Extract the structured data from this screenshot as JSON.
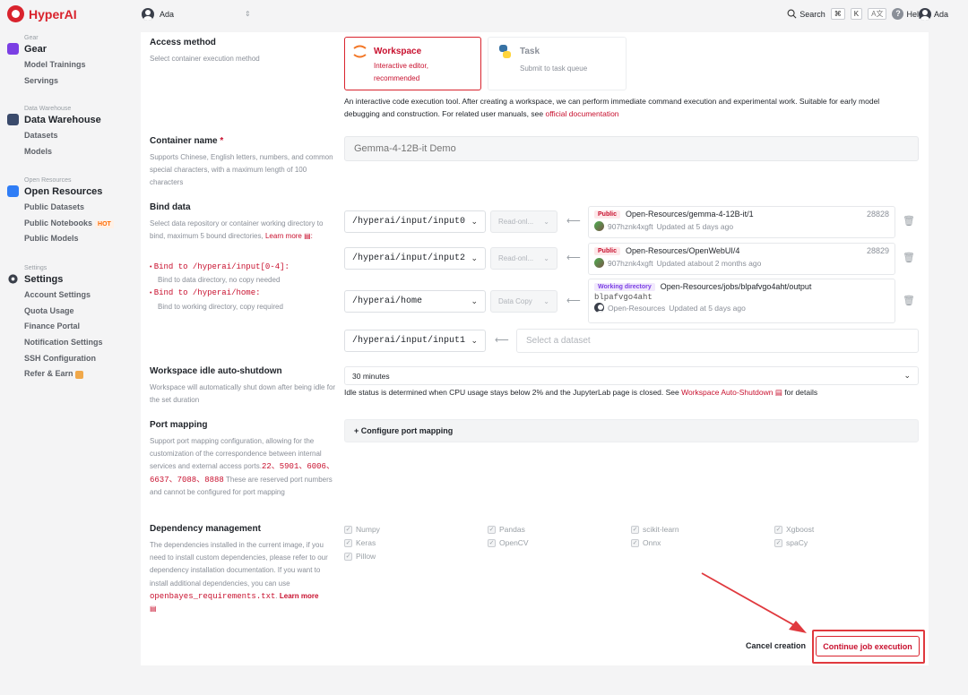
{
  "app": {
    "name": "HyperAI",
    "brand_color": "#d9232d"
  },
  "topbar": {
    "workspace_user": "Ada",
    "search_label": "Search",
    "shortcut_keys": [
      "⌘",
      "K"
    ],
    "help_label": "Help",
    "user_name": "Ada"
  },
  "sidebar": {
    "sections": [
      {
        "caption": "Gear",
        "title": "Gear",
        "items": [
          {
            "label": "Model Trainings"
          },
          {
            "label": "Servings"
          }
        ]
      },
      {
        "caption": "Data Warehouse",
        "title": "Data Warehouse",
        "items": [
          {
            "label": "Datasets"
          },
          {
            "label": "Models"
          }
        ]
      },
      {
        "caption": "Open Resources",
        "title": "Open Resources",
        "items": [
          {
            "label": "Public Datasets"
          },
          {
            "label": "Public Notebooks",
            "badge": "HOT"
          },
          {
            "label": "Public Models"
          }
        ]
      },
      {
        "caption": "Settings",
        "title": "Settings",
        "items": [
          {
            "label": "Account Settings"
          },
          {
            "label": "Quota Usage"
          },
          {
            "label": "Finance Portal"
          },
          {
            "label": "Notification Settings"
          },
          {
            "label": "SSH Configuration"
          },
          {
            "label": "Refer & Earn"
          }
        ]
      }
    ]
  },
  "access": {
    "label": "Access method",
    "desc": "Select container execution method",
    "options": [
      {
        "title": "Workspace",
        "sub": "Interactive editor, recommended",
        "selected": true
      },
      {
        "title": "Task",
        "sub": "Submit to task queue",
        "selected": false
      }
    ],
    "note": "An interactive code execution tool. After creating a workspace, we can perform immediate command execution and experimental work. Suitable for early model debugging and construction. For related user manuals, see",
    "note_link": "official documentation"
  },
  "container": {
    "label": "Container name",
    "required": "*",
    "desc": "Supports Chinese, English letters, numbers, and common special characters, with a maximum length of 100 characters",
    "placeholder": "Gemma-4-12B-it Demo"
  },
  "bind": {
    "label": "Bind data",
    "desc": "Select data repository or container working directory to bind, maximum 5 bound directories,",
    "learn_more": "Learn more",
    "rule1_path": "Bind to /hyperai/input[0-4]:",
    "rule1_desc": "Bind to data directory, no copy needed",
    "rule2_path": "Bind to /hyperai/home:",
    "rule2_desc": "Bind to working directory, copy required",
    "rows": [
      {
        "path": "/hyperai/input/input0",
        "mode": "Read-onl...",
        "badge": "Public",
        "name": "Open-Resources/gemma-4-12B-it/1",
        "num": "28828",
        "owner": "907hznk4xgft",
        "updated": "Updated at 5 days ago"
      },
      {
        "path": "/hyperai/input/input2",
        "mode": "Read-onl...",
        "badge": "Public",
        "name": "Open-Resources/OpenWebUI/4",
        "num": "28829",
        "owner": "907hznk4xgft",
        "updated": "Updated atabout 2 months ago"
      },
      {
        "path": "/hyperai/home",
        "mode": "Data Copy",
        "badge": "Working directory",
        "name": "Open-Resources/jobs/blpafvgo4aht/output",
        "id": "blpafvgo4aht",
        "owner": "Open-Resources",
        "updated": "Updated at 5 days ago"
      },
      {
        "path": "/hyperai/input/input1",
        "placeholder": "Select a dataset"
      }
    ]
  },
  "idle": {
    "label": "Workspace idle auto-shutdown",
    "desc": "Workspace will automatically shut down after being idle for the set duration",
    "value": "30 minutes",
    "note": "Idle status is determined when CPU usage stays below 2% and the JupyterLab page is closed. See",
    "link": "Workspace Auto-Shutdown",
    "note_end": "for details"
  },
  "ports": {
    "label": "Port mapping",
    "desc": "Support port mapping configuration, allowing for the customization of the correspondence between internal services and external access ports.",
    "reserved": "22、5901、6006、6637、7088、8888",
    "desc2": "These are reserved port numbers and cannot be configured for port mapping",
    "button": "+ Configure port mapping"
  },
  "deps": {
    "label": "Dependency management",
    "desc": "The dependencies installed in the current image, if you need to install custom dependencies, please refer to our dependency installation documentation. If you want to install additional dependencies, you can use",
    "file": "openbayes_requirements.txt",
    "learn_more": "Learn more",
    "packages": [
      "Numpy",
      "Pandas",
      "scikit-learn",
      "Xgboost",
      "Keras",
      "OpenCV",
      "Onnx",
      "spaCy",
      "Pillow"
    ]
  },
  "footer": {
    "cancel": "Cancel creation",
    "continue": "Continue job execution",
    "highlight_color": "#e0393e"
  }
}
